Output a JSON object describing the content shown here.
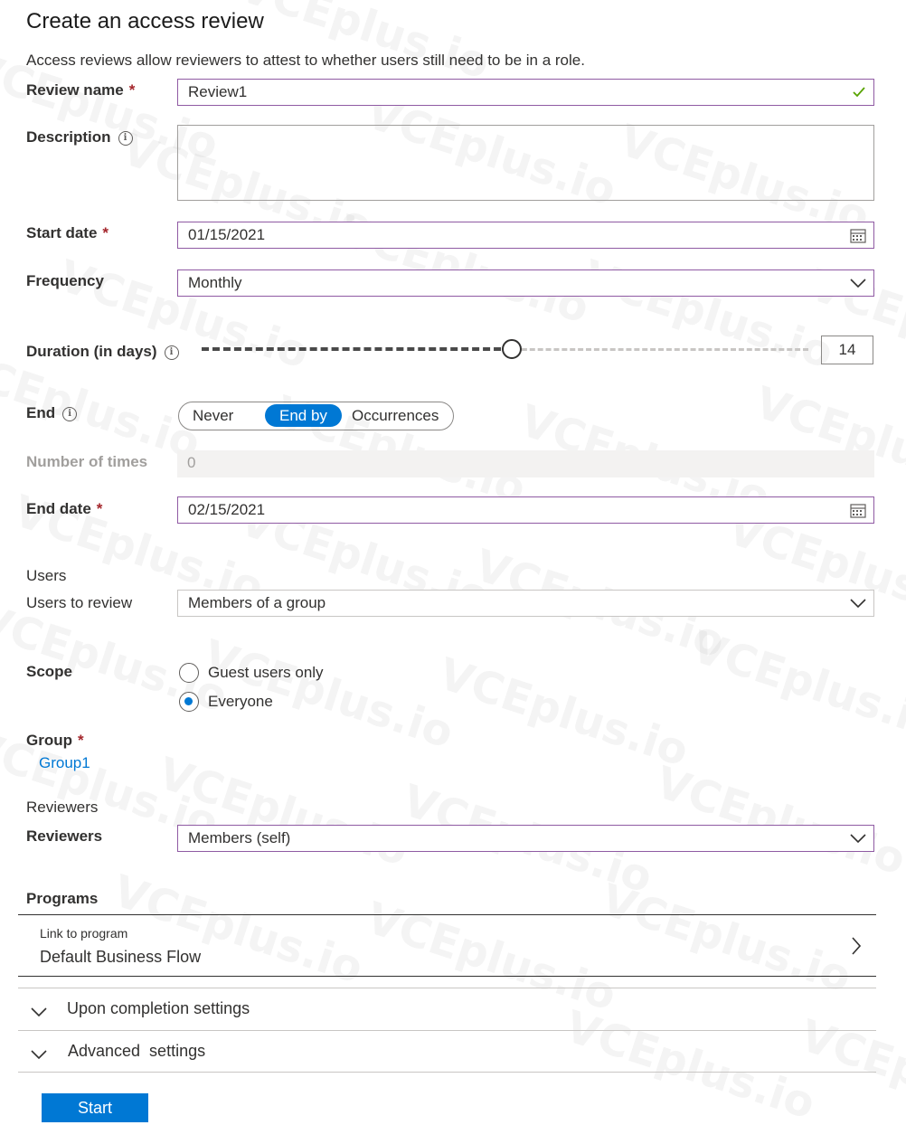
{
  "title": "Create an access review",
  "subtitle": "Access reviews allow reviewers to attest to whether users still need to be in a role.",
  "review_name": {
    "label": "Review name",
    "value": "Review1"
  },
  "description": {
    "label": "Description",
    "value": ""
  },
  "start_date": {
    "label": "Start date",
    "value": "01/15/2021"
  },
  "frequency": {
    "label": "Frequency",
    "value": "Monthly"
  },
  "duration": {
    "label": "Duration (in days)",
    "value": "14",
    "slider_fraction": 0.5
  },
  "end": {
    "label": "End",
    "options": [
      "Never",
      "End by",
      "Occurrences"
    ],
    "selected": "End by"
  },
  "number_of_times": {
    "label": "Number of times",
    "value": "0"
  },
  "end_date": {
    "label": "End date",
    "value": "02/15/2021"
  },
  "users": {
    "section": "Users",
    "users_to_review_label": "Users to review",
    "users_to_review_value": "Members of a group",
    "scope_label": "Scope",
    "scope_options": [
      "Guest users only",
      "Everyone"
    ],
    "scope_selected": "Everyone",
    "group_label": "Group",
    "group_value": "Group1"
  },
  "reviewers": {
    "section": "Reviewers",
    "label": "Reviewers",
    "value": "Members (self)"
  },
  "programs": {
    "label": "Programs",
    "link_label": "Link to program",
    "link_value": "Default Business Flow"
  },
  "upon_completion": "Upon completion settings",
  "advanced": "Advanced  settings",
  "start_button": "Start",
  "watermark": "VCEplus.io",
  "colors": {
    "accent": "#0078d4",
    "field_border": "#8f5aa3",
    "required": "#a4262c",
    "valid": "#57a300"
  }
}
